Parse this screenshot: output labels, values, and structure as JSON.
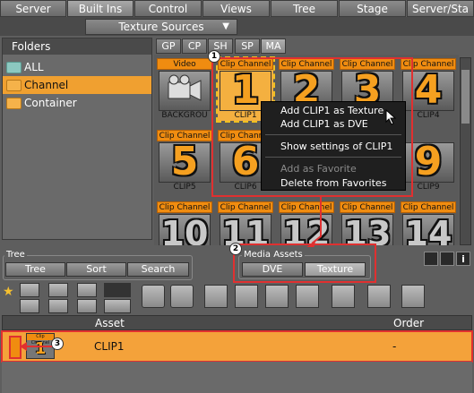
{
  "top_tabs": [
    "Server",
    "Built Ins",
    "Control",
    "Views",
    "Tree",
    "Stage",
    "Server/Sta"
  ],
  "active_top_tab": "Built Ins",
  "texture_sources": {
    "label": "Texture Sources",
    "arrow": "▼"
  },
  "folders": {
    "header": "Folders",
    "items": [
      {
        "label": "ALL",
        "icon": "teal-folder-icon",
        "selected": false
      },
      {
        "label": "Channel",
        "icon": "orange-folder-icon",
        "selected": true
      },
      {
        "label": "Container",
        "icon": "orange-folder-icon",
        "selected": false
      }
    ]
  },
  "asset_tabs": [
    "GP",
    "CP",
    "SH",
    "SP",
    "MA"
  ],
  "active_asset_tab": "MA",
  "tiles": [
    {
      "title": "Video",
      "glyph": "",
      "caption": "BACKGROU",
      "kind": "video"
    },
    {
      "title": "Clip Channel",
      "glyph": "1",
      "caption": "CLIP1",
      "kind": "clip",
      "highlighted": true
    },
    {
      "title": "Clip Channel",
      "glyph": "2",
      "caption": "",
      "kind": "clip"
    },
    {
      "title": "Clip Channel",
      "glyph": "3",
      "caption": "",
      "kind": "clip"
    },
    {
      "title": "Clip Channel",
      "glyph": "4",
      "caption": "CLIP4",
      "kind": "clip"
    },
    {
      "title": "Clip Channel",
      "glyph": "5",
      "caption": "CLIP5",
      "kind": "clip"
    },
    {
      "title": "Clip Channel",
      "glyph": "6",
      "caption": "CLIP6",
      "kind": "clip"
    },
    {
      "title": "",
      "glyph": "",
      "caption": "",
      "kind": "hidden"
    },
    {
      "title": "",
      "glyph": "",
      "caption": "",
      "kind": "hidden"
    },
    {
      "title": "",
      "glyph": "9",
      "caption": "CLIP9",
      "kind": "clip"
    },
    {
      "title": "Clip Channel",
      "glyph": "10",
      "caption": "",
      "kind": "clip-gray"
    },
    {
      "title": "Clip Channel",
      "glyph": "11",
      "caption": "",
      "kind": "clip-gray"
    },
    {
      "title": "Clip Channel",
      "glyph": "12",
      "caption": "",
      "kind": "clip-gray"
    },
    {
      "title": "Clip Channel",
      "glyph": "13",
      "caption": "",
      "kind": "clip-gray"
    },
    {
      "title": "Clip Channel",
      "glyph": "14",
      "caption": "",
      "kind": "clip-gray"
    }
  ],
  "context_menu": {
    "items": [
      {
        "label": "Add CLIP1 as Texture",
        "enabled": true
      },
      {
        "label": "Add CLIP1 as DVE",
        "enabled": true
      },
      {
        "label": "Show settings of CLIP1",
        "enabled": true
      },
      {
        "label": "Add as Favorite",
        "enabled": false
      },
      {
        "label": "Delete from Favorites",
        "enabled": true
      }
    ]
  },
  "callouts": [
    "1",
    "2",
    "3"
  ],
  "tree_panel": {
    "label": "Tree",
    "buttons": [
      "Tree",
      "Sort",
      "Search"
    ]
  },
  "media_assets": {
    "label": "Media Assets",
    "buttons": [
      "DVE",
      "Texture"
    ],
    "active": "Texture"
  },
  "asset_list": {
    "columns": [
      "Asset",
      "Order"
    ],
    "rows": [
      {
        "thumb_title": "Clip Channel",
        "thumb_glyph": "1",
        "asset": "CLIP1",
        "order": "-"
      }
    ]
  },
  "colors": {
    "accent": "#f4a23a",
    "annotation": "#e03030"
  }
}
